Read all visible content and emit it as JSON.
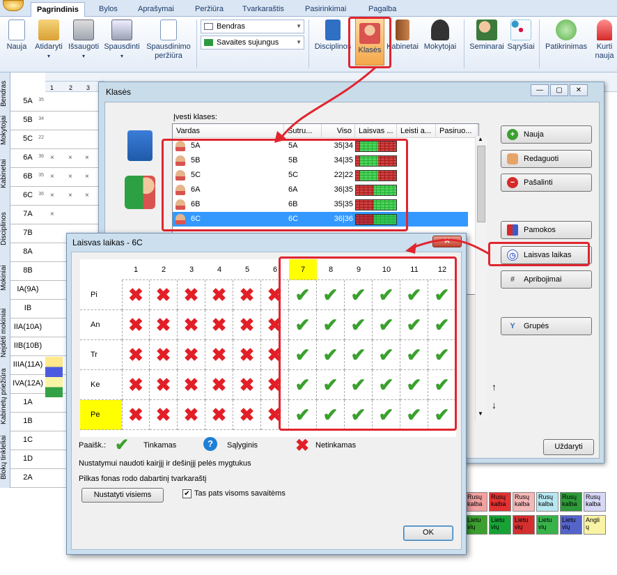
{
  "ribbon": {
    "tabs": [
      "Pagrindinis",
      "Bylos",
      "Aprašymai",
      "Peržiūra",
      "Tvarkaraštis",
      "Pasirinkimai",
      "Pagalba"
    ],
    "buttons": [
      {
        "label": "Nauja",
        "icon": "new-file-icon"
      },
      {
        "label": "Atidaryti",
        "icon": "folder-icon"
      },
      {
        "label": "Išsaugoti",
        "icon": "floppy-icon"
      },
      {
        "label": "Spausdinti",
        "icon": "printer-icon"
      },
      {
        "label": "Spausdinimo peržiūra",
        "icon": "print-preview-icon"
      },
      {
        "label": "Disciplinos",
        "icon": "book-icon"
      },
      {
        "label": "Klasės",
        "icon": "class-icon"
      },
      {
        "label": "Kabinetai",
        "icon": "door-icon"
      },
      {
        "label": "Mokytojai",
        "icon": "teacher-icon"
      },
      {
        "label": "Seminarai",
        "icon": "seminar-icon"
      },
      {
        "label": "Sąryšiai",
        "icon": "relations-icon"
      },
      {
        "label": "Patikrinimas",
        "icon": "check-icon"
      },
      {
        "label": "Kurti nauja",
        "icon": "siren-icon"
      }
    ],
    "combo1": "Bendras",
    "combo2": "Savaites sujungus"
  },
  "background": {
    "vertical_tabs": [
      "Bendras",
      "Mokytojai",
      "Kabinetai",
      "Disciplinos",
      "Mokiniai",
      "Neįdėti mokiniai",
      "Kabinetų priežiūra",
      "Blokų tinkleliai"
    ],
    "row_labels": [
      "5A",
      "5B",
      "5C",
      "6A",
      "6B",
      "6C",
      "7A",
      "7B",
      "8A",
      "8B",
      "IA(9A)",
      "IB",
      "IIA(10A)",
      "IIB(10B)",
      "IIIA(11A)",
      "IVA(12A)",
      "1A",
      "1B",
      "1C",
      "1D",
      "2A"
    ],
    "row_counts": [
      "35",
      "34",
      "22",
      "36",
      "35",
      "36",
      "",
      "",
      "",
      "",
      "",
      "",
      "",
      "",
      "",
      "",
      "",
      "",
      "",
      "",
      ""
    ],
    "col_numbers": [
      "1",
      "2",
      "3"
    ],
    "tiles": [
      {
        "line1": "Rusų",
        "line2": "kalba",
        "color": "#f2a1a1"
      },
      {
        "line1": "Rusų",
        "line2": "kalba",
        "color": "#e23232"
      },
      {
        "line1": "Rusų",
        "line2": "kalba",
        "color": "#f5b8b8"
      },
      {
        "line1": "Rusų",
        "line2": "kalba",
        "color": "#b8e7f0"
      },
      {
        "line1": "Rusų",
        "line2": "kalba",
        "color": "#2f9a3a"
      },
      {
        "line1": "Rusų",
        "line2": "kalba",
        "color": "#d7d7f7"
      },
      {
        "line1": "Lietu",
        "line2": "vių",
        "color": "#3ba02e"
      },
      {
        "line1": "Lietu",
        "line2": "vių",
        "color": "#17a236"
      },
      {
        "line1": "Lietu",
        "line2": "vių",
        "color": "#d32f2f"
      },
      {
        "line1": "Lietu",
        "line2": "vių",
        "color": "#38b34a"
      },
      {
        "line1": "Lietu",
        "line2": "vių",
        "color": "#5564c8"
      },
      {
        "line1": "Angli",
        "line2": "ų",
        "color": "#f9f3a5"
      }
    ]
  },
  "klases_window": {
    "title": "Klasės",
    "grid_caption": "Įvesti klases:",
    "columns": [
      "Vardas",
      "Sutru...",
      "Viso",
      "Laisvas ...",
      "Leisti a...",
      "Pasiruo..."
    ],
    "rows": [
      {
        "name": "5A",
        "short": "5A",
        "total": "35|34"
      },
      {
        "name": "5B",
        "short": "5B",
        "total": "34|35"
      },
      {
        "name": "5C",
        "short": "5C",
        "total": "22|22"
      },
      {
        "name": "6A",
        "short": "6A",
        "total": "36|35"
      },
      {
        "name": "6B",
        "short": "6B",
        "total": "35|35"
      },
      {
        "name": "6C",
        "short": "6C",
        "total": "36|36"
      }
    ],
    "buttons": [
      "Nauja",
      "Redaguoti",
      "Pašalinti",
      "Pamokos",
      "Laisvas laikas",
      "Apribojimai",
      "Grupės"
    ],
    "close_label": "Uždaryti",
    "window_controls": [
      "—",
      "▢",
      "✕"
    ]
  },
  "laisvas_dialog": {
    "title": "Laisvas laikas - 6C",
    "columns": [
      "1",
      "2",
      "3",
      "4",
      "5",
      "6",
      "7",
      "8",
      "9",
      "10",
      "11",
      "12"
    ],
    "days": [
      "Pi",
      "An",
      "Tr",
      "Ke",
      "Pe"
    ],
    "legend_title": "Paaišk.:",
    "legend_ok": "Tinkamas",
    "legend_cond": "Sąlyginis",
    "legend_bad": "Netinkamas",
    "hint1": "Nustatymui naudoti kairįjį ir dešinįjį pelės mygtukus",
    "hint2": "Pilkas fonas rodo dabartinį tvarkaraštį",
    "set_all_label": "Nustatyti visiems",
    "same_weeks_label": "Tas pats visoms savaitėms",
    "same_weeks_checked": true,
    "ok_label": "OK",
    "close_label": "✕",
    "highlight_color": "#ffff00"
  },
  "colors": {
    "accent": "#3399ff",
    "annotation": "#e0252f",
    "ok": "#3ba02e",
    "bad": "#e21f26",
    "cond": "#1e7fd6"
  }
}
